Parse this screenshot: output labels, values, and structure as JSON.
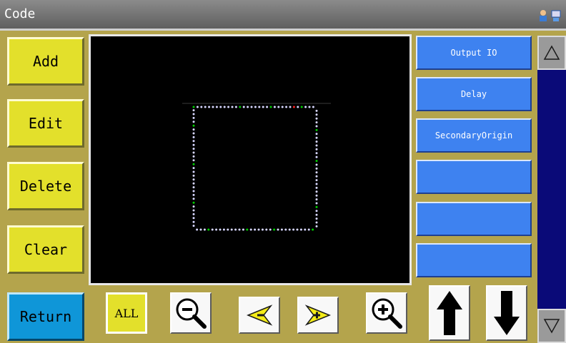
{
  "window": {
    "title": "Code"
  },
  "left_buttons": {
    "add": "Add",
    "edit": "Edit",
    "delete": "Delete",
    "clear": "Clear"
  },
  "right_buttons": {
    "output_io": "Output IO",
    "delay": "Delay",
    "secondary_origin": "SecondaryOrigin",
    "empty1": "",
    "empty2": "",
    "empty3": ""
  },
  "bottom_bar": {
    "return": "Return",
    "all": "ALL"
  },
  "icons": {
    "status": "user-network-icon",
    "zoom_out": "zoom-out-icon",
    "zoom_in": "zoom-in-icon",
    "prev": "arrow-left-icon",
    "next": "arrow-right-icon",
    "up": "arrow-up-icon",
    "down": "arrow-down-icon",
    "scroll_up": "scroll-up-icon",
    "scroll_down": "scroll-down-icon"
  },
  "colors": {
    "background": "#b4a44c",
    "canvas": "#000000",
    "action_button": "#e3e02b",
    "function_button": "#3e82f0",
    "return_button": "#0f96d8",
    "scroll_track": "#0a0a78",
    "point_default": "#d7d7ff",
    "point_highlight": "#00d000",
    "point_current": "#ff2020"
  }
}
